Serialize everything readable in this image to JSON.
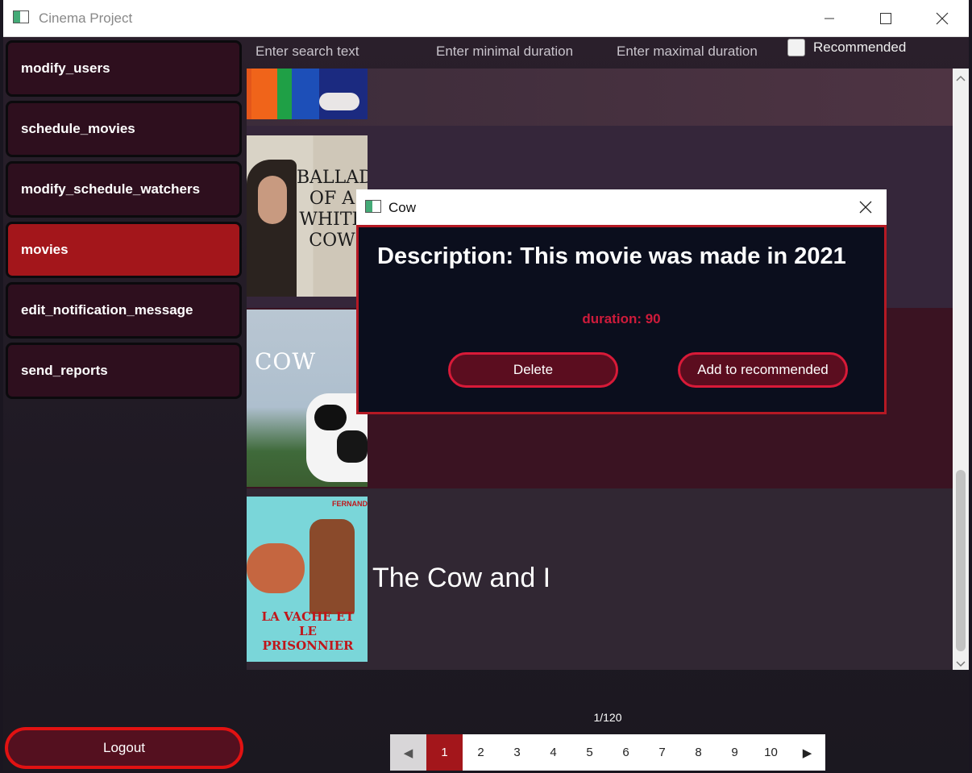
{
  "window": {
    "title": "Cinema Project"
  },
  "sidebar": {
    "items": [
      {
        "label": "modify_users"
      },
      {
        "label": "schedule_movies"
      },
      {
        "label": "modify_schedule_watchers"
      },
      {
        "label": "movies"
      },
      {
        "label": "edit_notification_message"
      },
      {
        "label": "send_reports"
      }
    ],
    "active": "movies"
  },
  "logout_label": "Logout",
  "filters": {
    "search_placeholder": "Enter search text",
    "min_placeholder": "Enter minimal duration",
    "max_placeholder": "Enter maximal duration",
    "recommended_label": "Recommended"
  },
  "movies": [
    {
      "poster_text": "BALLAD OF A WHITE COW",
      "title": ""
    },
    {
      "poster_text": "COW",
      "title": ""
    },
    {
      "poster_text": "LA VACHE ET LE PRISONNIER",
      "poster_top": "FERNANDEL",
      "title": "The Cow and I"
    }
  ],
  "dialog": {
    "title": "Cow",
    "description": "Description: This movie was made in 2021",
    "duration": "duration: 90",
    "delete_label": "Delete",
    "recommend_label": "Add to recommended"
  },
  "pagination": {
    "info": "1/120",
    "pages": [
      "1",
      "2",
      "3",
      "4",
      "5",
      "6",
      "7",
      "8",
      "9",
      "10"
    ],
    "current": "1"
  },
  "colors": {
    "accent": "#a3161b",
    "dialog_border": "#b51924",
    "duration_text": "#cf1b3b"
  }
}
